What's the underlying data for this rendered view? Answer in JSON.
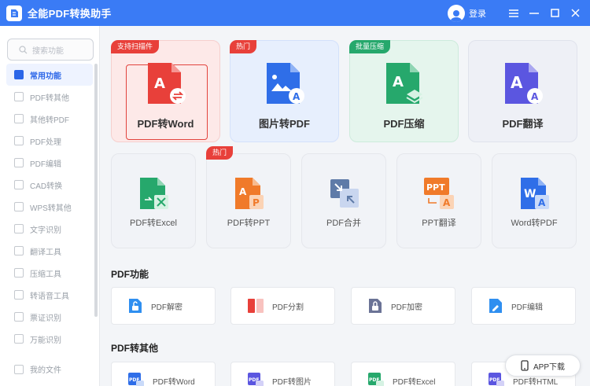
{
  "app": {
    "title": "全能PDF转换助手",
    "login": "登录"
  },
  "sidebar": {
    "search_placeholder": "搜索功能",
    "items": [
      {
        "label": "常用功能",
        "active": true
      },
      {
        "label": "PDF转其他"
      },
      {
        "label": "其他转PDF"
      },
      {
        "label": "PDF处理"
      },
      {
        "label": "PDF编辑"
      },
      {
        "label": "CAD转换"
      },
      {
        "label": "WPS转其他"
      },
      {
        "label": "文字识别"
      },
      {
        "label": "翻译工具"
      },
      {
        "label": "压缩工具"
      },
      {
        "label": "转语音工具"
      },
      {
        "label": "票证识别"
      },
      {
        "label": "万能识别"
      }
    ],
    "my_files": "我的文件"
  },
  "big_cards": [
    {
      "label": "PDF转Word",
      "tag": "支持扫描件",
      "color": "#e8403a"
    },
    {
      "label": "图片转PDF",
      "tag": "热门",
      "color": "#2f6ee8"
    },
    {
      "label": "PDF压缩",
      "tag": "批量压缩",
      "color": "#26a86c"
    },
    {
      "label": "PDF翻译",
      "tag": "",
      "color": "#5b56e0"
    }
  ],
  "small_cards": [
    {
      "label": "PDF转Excel",
      "tag": ""
    },
    {
      "label": "PDF转PPT",
      "tag": "热门"
    },
    {
      "label": "PDF合并",
      "tag": ""
    },
    {
      "label": "PPT翻译",
      "tag": ""
    },
    {
      "label": "Word转PDF",
      "tag": ""
    }
  ],
  "sections": {
    "pdf_functions": {
      "title": "PDF功能",
      "items": [
        {
          "label": "PDF解密"
        },
        {
          "label": "PDF分割"
        },
        {
          "label": "PDF加密"
        },
        {
          "label": "PDF编辑"
        }
      ]
    },
    "pdf_to_other": {
      "title": "PDF转其他",
      "items": [
        {
          "label": "PDF转Word"
        },
        {
          "label": "PDF转图片"
        },
        {
          "label": "PDF转Excel"
        },
        {
          "label": "PDF转HTML"
        }
      ]
    }
  },
  "app_download": "APP下载",
  "colors": {
    "titlebar": "#3a7bf5",
    "accent": "#2b66e8"
  }
}
